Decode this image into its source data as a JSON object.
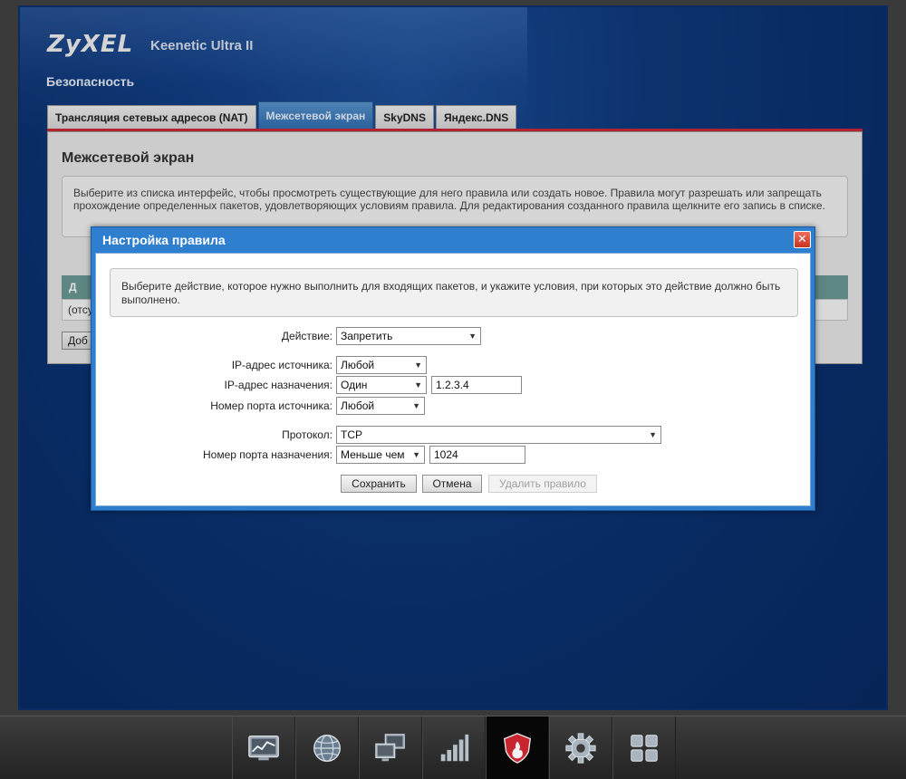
{
  "brand": {
    "logo": "ZyXEL",
    "model": "Keenetic Ultra II"
  },
  "section_title": "Безопасность",
  "tabs": [
    {
      "label": "Трансляция сетевых адресов (NAT)",
      "active": false
    },
    {
      "label": "Межсетевой экран",
      "active": true
    },
    {
      "label": "SkyDNS",
      "active": false
    },
    {
      "label": "Яндекс.DNS",
      "active": false
    }
  ],
  "panel": {
    "title": "Межсетевой экран",
    "info": "Выберите из списка интерфейс, чтобы просмотреть существующие для него правила или создать новое. Правила могут разрешать или запрещать прохождение определенных пакетов, удовлетворяющих условиям правила. Для редактирования созданного правила щелкните его запись в списке.",
    "table_head_partial": "Д",
    "row_partial": "(отсу",
    "add_button_partial": "Доб"
  },
  "dialog": {
    "title": "Настройка правила",
    "close_label": "✕",
    "info": "Выберите действие, которое нужно выполнить для входящих пакетов, и укажите условия, при которых это действие должно быть выполнено.",
    "fields": {
      "action": {
        "label": "Действие:",
        "value": "Запретить"
      },
      "src_ip": {
        "label": "IP-адрес источника:",
        "value": "Любой"
      },
      "dst_ip": {
        "label": "IP-адрес назначения:",
        "value": "Один",
        "address": "1.2.3.4"
      },
      "src_port": {
        "label": "Номер порта источника:",
        "value": "Любой"
      },
      "protocol": {
        "label": "Протокол:",
        "value": "TCP"
      },
      "dst_port": {
        "label": "Номер порта назначения:",
        "value": "Меньше чем",
        "port": "1024"
      }
    },
    "buttons": {
      "save": "Сохранить",
      "cancel": "Отмена",
      "delete": "Удалить правило"
    }
  },
  "taskbar": [
    {
      "name": "monitor-icon",
      "active": false
    },
    {
      "name": "globe-icon",
      "active": false
    },
    {
      "name": "home-network-icon",
      "active": false
    },
    {
      "name": "wifi-signal-icon",
      "active": false
    },
    {
      "name": "security-shield-icon",
      "active": true
    },
    {
      "name": "gear-icon",
      "active": false
    },
    {
      "name": "apps-grid-icon",
      "active": false
    }
  ],
  "colors": {
    "accent_blue": "#2f7fcf",
    "tab_red_line": "#c8283a",
    "workspace_blue": "#0e3a7e",
    "close_red": "#d9432e"
  }
}
